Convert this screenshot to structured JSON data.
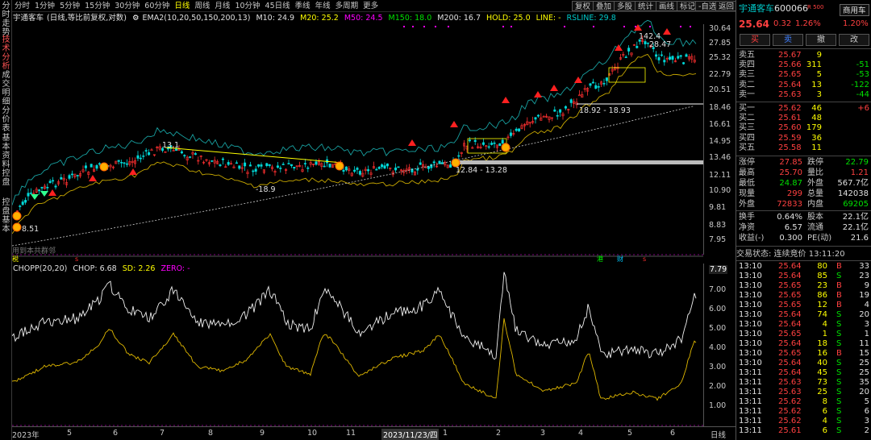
{
  "left_tabs": [
    "分时走势",
    "技术分析",
    "成交明细",
    "分价表",
    "基本资料",
    "控盘",
    "控盘基本"
  ],
  "left_tab_active": 1,
  "periods": [
    "分时",
    "1分钟",
    "5分钟",
    "15分钟",
    "30分钟",
    "60分钟",
    "日线",
    "周线",
    "月线",
    "10分钟",
    "45日线",
    "季线",
    "年线",
    "多周期",
    "更多"
  ],
  "period_active": 6,
  "toolbar": [
    "复权",
    "叠加",
    "多股",
    "统计",
    "画线",
    "标记",
    "-自选",
    "返回"
  ],
  "legend_main": {
    "name": "宇通客车",
    "mode": "(日线,等比前复权,对数)",
    "ema": "EMA2(10,20,50,150,200,13)",
    "m10": "M10: 24.9",
    "m20": "M20: 25.2",
    "m50": "M50: 24.5",
    "m150": "M150: 18.0",
    "m200": "M200: 16.7",
    "hold": "HOLD: 25.0",
    "line": "LINE: -",
    "rsline": "RSLINE: 29.8"
  },
  "legend_sub": {
    "name": "CHOPP(20,20)",
    "chop": "CHOP: 6.68",
    "sd": "SD: 2.26",
    "zero": "ZERO: -"
  },
  "main_yticks": [
    "30.64",
    "27.85",
    "25.32",
    "22.79",
    "20.51",
    "18.46",
    "16.61",
    "14.95",
    "13.46",
    "12.11",
    "10.90",
    "9.81",
    "8.83",
    "7.95"
  ],
  "sub_yticks": [
    "7.79",
    "7.00",
    "6.00",
    "5.00",
    "4.00",
    "3.00",
    "2.00",
    "1.00"
  ],
  "xticks": [
    "2023年",
    "5",
    "6",
    "7",
    "8",
    "9",
    "10",
    "11",
    "2023/11/23/四",
    "1",
    "2",
    "3",
    "4",
    "5",
    "6",
    "日线"
  ],
  "annotations": {
    "high": "142.4",
    "high2": "28.47",
    "range1": "18.92 - 18.93",
    "range2": "12.84 - 13.28",
    "label_131": "13.1",
    "low": "-18.9",
    "start": "8.51",
    "wm": "用到本共群邻",
    "left_flag": "税",
    "flag_s": "s",
    "flag_gang": "港",
    "flag_cai": "财",
    "flag_s2": "s"
  },
  "quote": {
    "name": "宇通客车",
    "code": "600066",
    "tag": "R 500",
    "btn_merchant": "商用车",
    "price": "25.64",
    "change": "0.32",
    "pct": "1.26%",
    "right_pct": "1.20%",
    "buttons": [
      "买",
      "卖",
      "撤",
      "改"
    ],
    "sells": [
      [
        "卖五",
        "25.67",
        "9",
        ""
      ],
      [
        "卖四",
        "25.66",
        "311",
        "-51"
      ],
      [
        "卖三",
        "25.65",
        "5",
        "-53"
      ],
      [
        "卖二",
        "25.64",
        "13",
        "-122"
      ],
      [
        "卖一",
        "25.63",
        "3",
        "-44"
      ]
    ],
    "buys": [
      [
        "买一",
        "25.62",
        "46",
        "+6"
      ],
      [
        "买二",
        "25.61",
        "48",
        ""
      ],
      [
        "买三",
        "25.60",
        "179",
        ""
      ],
      [
        "买四",
        "25.59",
        "36",
        ""
      ],
      [
        "买五",
        "25.58",
        "11",
        ""
      ]
    ],
    "stats": [
      [
        "涨停",
        "27.85",
        "跌停",
        "22.79"
      ],
      [
        "最高",
        "25.70",
        "量比",
        "1.21"
      ],
      [
        "最低",
        "24.87",
        "外盘",
        "567.7亿"
      ],
      [
        "现量",
        "299",
        "总量",
        "142038"
      ],
      [
        "外盘",
        "72833",
        "内盘",
        "69205"
      ]
    ],
    "stats2": [
      [
        "换手",
        "0.64%",
        "股本",
        "22.1亿"
      ],
      [
        "净资",
        "6.57",
        "流通",
        "22.1亿"
      ],
      [
        "收益(-)",
        "0.300",
        "PE(动)",
        "21.6"
      ]
    ],
    "status": "交易状态: 连续竞价 13:11:20",
    "ticks": [
      [
        "13:10",
        "25.64",
        "80",
        "B",
        "33"
      ],
      [
        "13:10",
        "25.64",
        "85",
        "S",
        "23"
      ],
      [
        "13:10",
        "25.65",
        "23",
        "B",
        "9"
      ],
      [
        "13:10",
        "25.65",
        "86",
        "B",
        "19"
      ],
      [
        "13:10",
        "25.65",
        "12",
        "B",
        "4"
      ],
      [
        "13:10",
        "25.64",
        "74",
        "S",
        "20"
      ],
      [
        "13:10",
        "25.64",
        "4",
        "S",
        "3"
      ],
      [
        "13:10",
        "25.65",
        "1",
        "S",
        "1"
      ],
      [
        "13:10",
        "25.64",
        "18",
        "S",
        "11"
      ],
      [
        "13:10",
        "25.65",
        "16",
        "B",
        "15"
      ],
      [
        "13:10",
        "25.64",
        "40",
        "S",
        "25"
      ],
      [
        "13:11",
        "25.64",
        "45",
        "S",
        "25"
      ],
      [
        "13:11",
        "25.63",
        "73",
        "S",
        "35"
      ],
      [
        "13:11",
        "25.63",
        "25",
        "S",
        "20"
      ],
      [
        "13:11",
        "25.62",
        "8",
        "S",
        "5"
      ],
      [
        "13:11",
        "25.62",
        "6",
        "S",
        "6"
      ],
      [
        "13:11",
        "25.62",
        "4",
        "S",
        "3"
      ],
      [
        "13:11",
        "25.61",
        "6",
        "S",
        "2"
      ]
    ]
  }
}
